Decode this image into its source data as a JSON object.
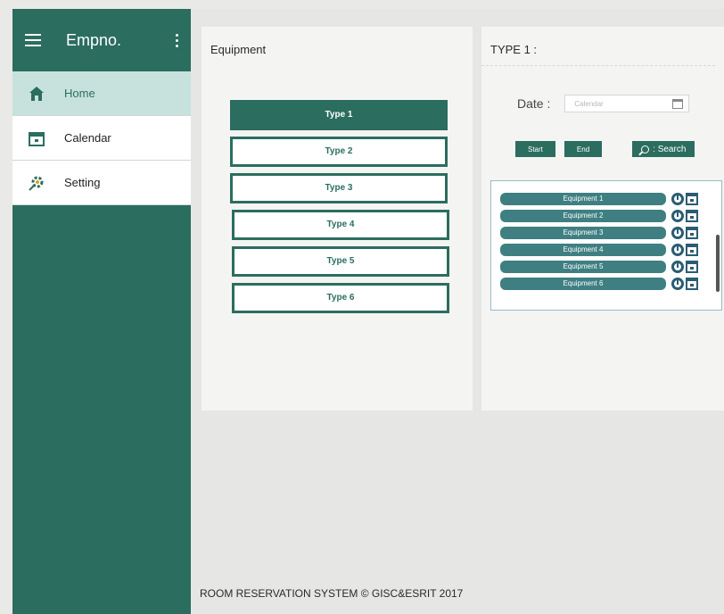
{
  "sidebar": {
    "title": "Empno.",
    "items": [
      {
        "label": "Home",
        "icon": "home-icon"
      },
      {
        "label": "Calendar",
        "icon": "calendar-icon"
      },
      {
        "label": "Setting",
        "icon": "settings-icon"
      }
    ]
  },
  "equipment_panel": {
    "title": "Equipment",
    "types": [
      "Type 1",
      "Type 2",
      "Type 3",
      "Type 4",
      "Type 5",
      "Type 6"
    ],
    "selected": "Type 1"
  },
  "detail_panel": {
    "title": "TYPE 1 :",
    "date_label": "Date :",
    "calendar_placeholder": "Calendar",
    "start_label": "Start",
    "end_label": "End",
    "search_label": ": Search",
    "equipment": [
      "Equipment 1",
      "Equipment 2",
      "Equipment 3",
      "Equipment 4",
      "Equipment 5",
      "Equipment 6"
    ]
  },
  "footer": "ROOM RESERVATION SYSTEM © GISC&ESRIT 2017",
  "colors": {
    "primary": "#2b6d5f",
    "active_bg": "#c7e2dc",
    "equipment_btn": "#3f7f82"
  }
}
